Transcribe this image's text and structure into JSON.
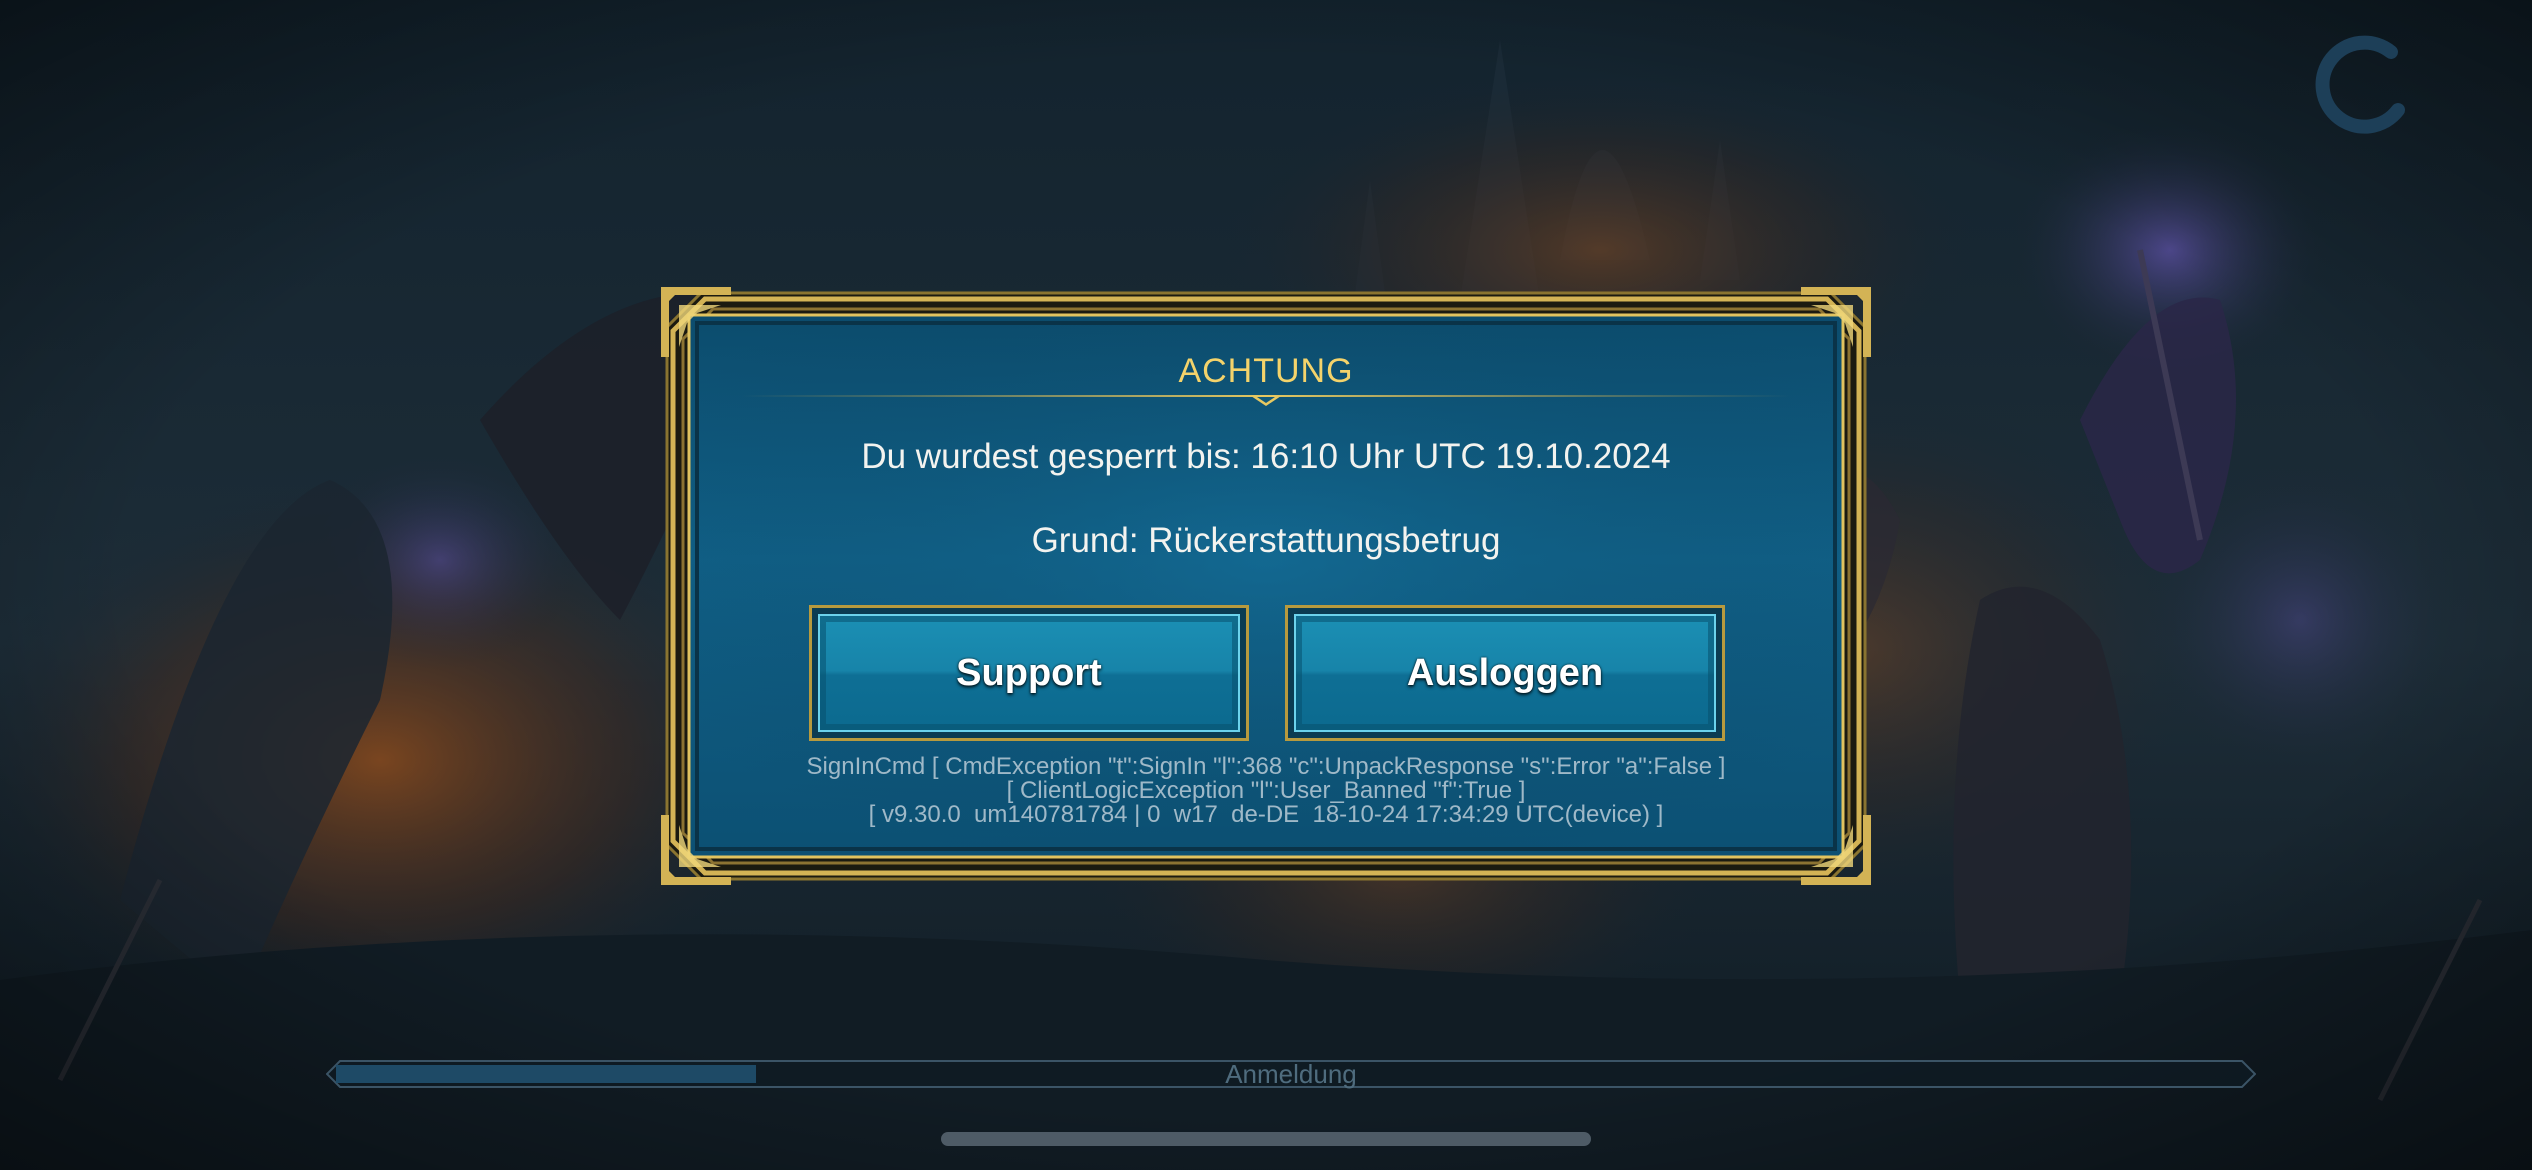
{
  "colors": {
    "title_gold": "#f4d36b",
    "frame_gold": "#c9a94a",
    "panel_blue": "#0f5a7c",
    "button_blue": "#1784a9",
    "progress_fill": "#1e4a66"
  },
  "icons": {
    "spinner": "loading-spinner-icon"
  },
  "dialog": {
    "title": "ACHTUNG",
    "ban_message": "Du wurdest gesperrt bis: 16:10 Uhr UTC 19.10.2024",
    "reason": "Grund: Rückerstattungsbetrug",
    "buttons": {
      "support": "Support",
      "logout": "Ausloggen"
    },
    "error_lines": [
      "SignInCmd [ CmdException \"t\":SignIn \"l\":368 \"c\":UnpackResponse \"s\":Error \"a\":False ]",
      "[ ClientLogicException \"l\":User_Banned \"f\":True ]",
      "[ v9.30.0  um140781784 | 0  w17  de-DE  18-10-24 17:34:29 UTC(device) ]"
    ]
  },
  "loading": {
    "label": "Anmeldung",
    "progress": 0.22
  }
}
